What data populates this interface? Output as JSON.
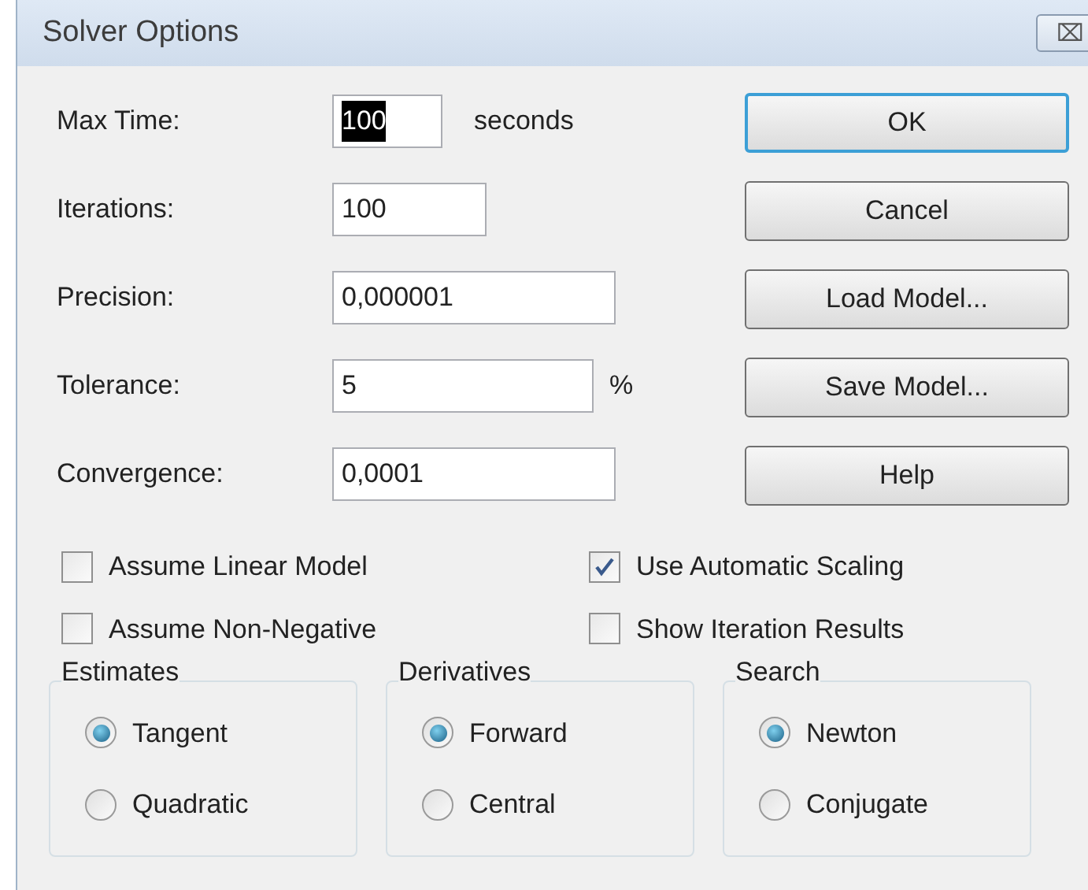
{
  "window": {
    "title": "Solver Options",
    "close": "⌧"
  },
  "fields": [
    {
      "label": "Max Time:",
      "value": "100",
      "unit": "seconds",
      "selected": true
    },
    {
      "label": "Iterations:",
      "value": "100",
      "selected": false
    },
    {
      "label": "Precision:",
      "value": "0,000001",
      "selected": false
    },
    {
      "label": "Tolerance:",
      "value": "5",
      "unit": "%",
      "selected": false
    },
    {
      "label": "Convergence:",
      "value": "0,0001",
      "selected": false
    }
  ],
  "buttons": [
    {
      "label": "OK",
      "default": true
    },
    {
      "label": "Cancel",
      "default": false
    },
    {
      "label": "Load Model...",
      "default": false
    },
    {
      "label": "Save Model...",
      "default": false
    },
    {
      "label": "Help",
      "default": false
    }
  ],
  "checkboxes": [
    {
      "label": "Assume Linear Model",
      "checked": false
    },
    {
      "label": "Use Automatic Scaling",
      "checked": true
    },
    {
      "label": "Assume Non-Negative",
      "checked": false
    },
    {
      "label": "Show Iteration Results",
      "checked": false
    }
  ],
  "groups": [
    {
      "title": "Estimates",
      "options": [
        {
          "label": "Tangent",
          "selected": true
        },
        {
          "label": "Quadratic",
          "selected": false
        }
      ]
    },
    {
      "title": "Derivatives",
      "options": [
        {
          "label": "Forward",
          "selected": true
        },
        {
          "label": "Central",
          "selected": false
        }
      ]
    },
    {
      "title": "Search",
      "options": [
        {
          "label": "Newton",
          "selected": true
        },
        {
          "label": "Conjugate",
          "selected": false
        }
      ]
    }
  ]
}
